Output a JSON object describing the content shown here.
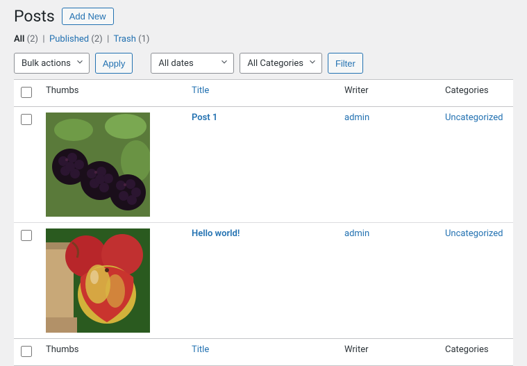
{
  "page": {
    "title": "Posts",
    "add_new": "Add New"
  },
  "views": {
    "all": {
      "label": "All",
      "count": "(2)"
    },
    "published": {
      "label": "Published",
      "count": "(2)"
    },
    "trash": {
      "label": "Trash",
      "count": "(1)"
    }
  },
  "nav": {
    "bulk_actions": "Bulk actions",
    "apply": "Apply",
    "dates": "All dates",
    "categories": "All Categories",
    "filter": "Filter"
  },
  "columns": {
    "thumbs": "Thumbs",
    "title": "Title",
    "writer": "Writer",
    "categories": "Categories"
  },
  "rows": [
    {
      "title": "Post 1",
      "writer": "admin",
      "categories": "Uncategorized",
      "thumb": "blackberries"
    },
    {
      "title": "Hello world!",
      "writer": "admin",
      "categories": "Uncategorized",
      "thumb": "apples"
    }
  ]
}
